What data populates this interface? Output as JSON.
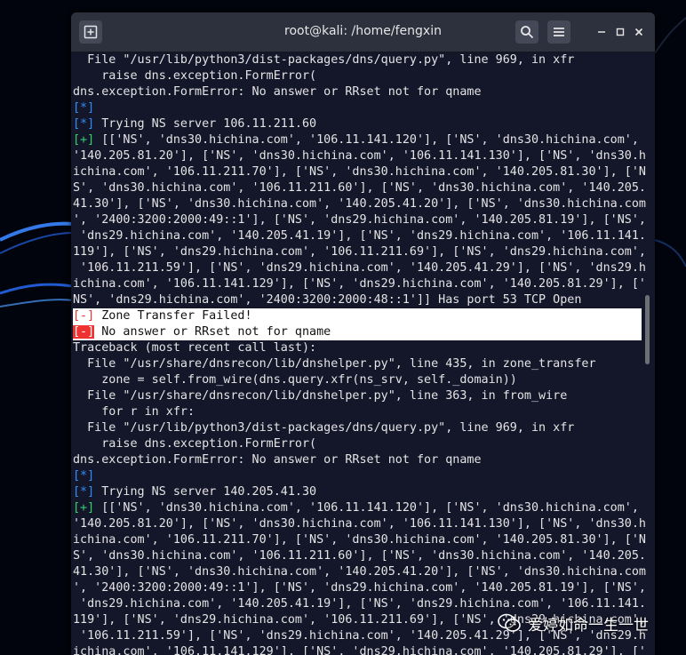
{
  "window": {
    "title": "root@kali: /home/fengxin",
    "new_tab_icon": "new-tab-icon",
    "search_icon": "search-icon",
    "menu_icon": "hamburger-menu-icon",
    "minimize_glyph": "–",
    "maximize_glyph": "□",
    "close_glyph": "✕"
  },
  "terminal": {
    "lines": [
      "  File \"/usr/lib/python3/dist-packages/dns/query.py\", line 969, in xfr",
      "    raise dns.exception.FormError(",
      "dns.exception.FormError: No answer or RRset not for qname",
      "[*]",
      "[*] Trying NS server 106.11.211.60",
      "[+] [['NS', 'dns30.hichina.com', '106.11.141.120'], ['NS', 'dns30.hichina.com',",
      "'140.205.81.20'], ['NS', 'dns30.hichina.com', '106.11.141.130'], ['NS', 'dns30.h",
      "ichina.com', '106.11.211.70'], ['NS', 'dns30.hichina.com', '140.205.81.30'], ['N",
      "S', 'dns30.hichina.com', '106.11.211.60'], ['NS', 'dns30.hichina.com', '140.205.",
      "41.30'], ['NS', 'dns30.hichina.com', '140.205.41.20'], ['NS', 'dns30.hichina.com",
      "', '2400:3200:2000:49::1'], ['NS', 'dns29.hichina.com', '140.205.81.19'], ['NS',",
      " 'dns29.hichina.com', '140.205.41.19'], ['NS', 'dns29.hichina.com', '106.11.141.",
      "119'], ['NS', 'dns29.hichina.com', '106.11.211.69'], ['NS', 'dns29.hichina.com',",
      " '106.11.211.59'], ['NS', 'dns29.hichina.com', '140.205.41.29'], ['NS', 'dns29.h",
      "ichina.com', '106.11.141.129'], ['NS', 'dns29.hichina.com', '140.205.81.29'], ['",
      "NS', 'dns29.hichina.com', '2400:3200:2000:48::1']] Has port 53 TCP Open",
      "[-] Zone Transfer Failed!",
      "[-] No answer or RRset not for qname",
      "Traceback (most recent call last):",
      "  File \"/usr/share/dnsrecon/lib/dnshelper.py\", line 435, in zone_transfer",
      "    zone = self.from_wire(dns.query.xfr(ns_srv, self._domain))",
      "  File \"/usr/share/dnsrecon/lib/dnshelper.py\", line 363, in from_wire",
      "    for r in xfr:",
      "  File \"/usr/lib/python3/dist-packages/dns/query.py\", line 969, in xfr",
      "    raise dns.exception.FormError(",
      "dns.exception.FormError: No answer or RRset not for qname",
      "[*]",
      "[*] Trying NS server 140.205.41.30",
      "[+] [['NS', 'dns30.hichina.com', '106.11.141.120'], ['NS', 'dns30.hichina.com',",
      "'140.205.81.20'], ['NS', 'dns30.hichina.com', '106.11.141.130'], ['NS', 'dns30.h",
      "ichina.com', '106.11.211.70'], ['NS', 'dns30.hichina.com', '140.205.81.30'], ['N",
      "S', 'dns30.hichina.com', '106.11.211.60'], ['NS', 'dns30.hichina.com', '140.205.",
      "41.30'], ['NS', 'dns30.hichina.com', '140.205.41.20'], ['NS', 'dns30.hichina.com",
      "', '2400:3200:2000:49::1'], ['NS', 'dns29.hichina.com', '140.205.81.19'], ['NS',",
      " 'dns29.hichina.com', '140.205.41.19'], ['NS', 'dns29.hichina.com', '106.11.141.",
      "119'], ['NS', 'dns29.hichina.com', '106.11.211.69'], ['NS', 'dns29.hichina.com',",
      " '106.11.211.59'], ['NS', 'dns29.hichina.com', '140.205.41.29'], ['NS', 'dns29.h",
      "ichina.com', '106.11.141.129'], ['NS', 'dns29.hichina.com', '140.205.81.29'], ['"
    ],
    "highlighted_lines": [
      16,
      17
    ]
  },
  "watermark": {
    "text": "爱婷如命一生一世",
    "icon": "wechat-icon"
  },
  "colors": {
    "prefix_info": "#2f8ffa",
    "prefix_ok": "#2ed36a",
    "prefix_err": "#ee3232",
    "terminal_bg": "#14162a",
    "titlebar_bg": "#2d303d",
    "text": "#e4e4e4"
  }
}
